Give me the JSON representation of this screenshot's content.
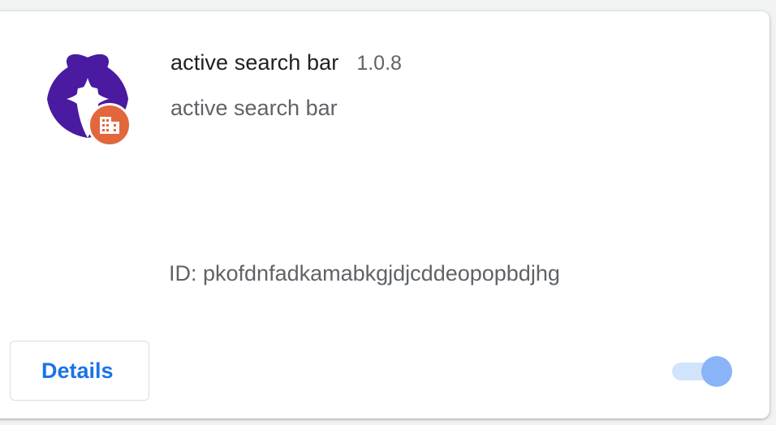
{
  "extension": {
    "name": "active search bar",
    "version": "1.0.8",
    "description": "active search bar",
    "id_text": "ID: pkofdnfadkamabkgjdjcddeopopbdjhg",
    "icon": "extension-logo-icon",
    "badge_icon": "enterprise-policy-building-icon",
    "enabled": true
  },
  "actions": {
    "details_label": "Details"
  },
  "colors": {
    "logo_purple": "#4a1aa0",
    "badge_orange": "#e2673d",
    "accent_blue": "#1a73e8",
    "toggle_track": "#d2e3fc",
    "toggle_knob": "#8ab4f8"
  }
}
